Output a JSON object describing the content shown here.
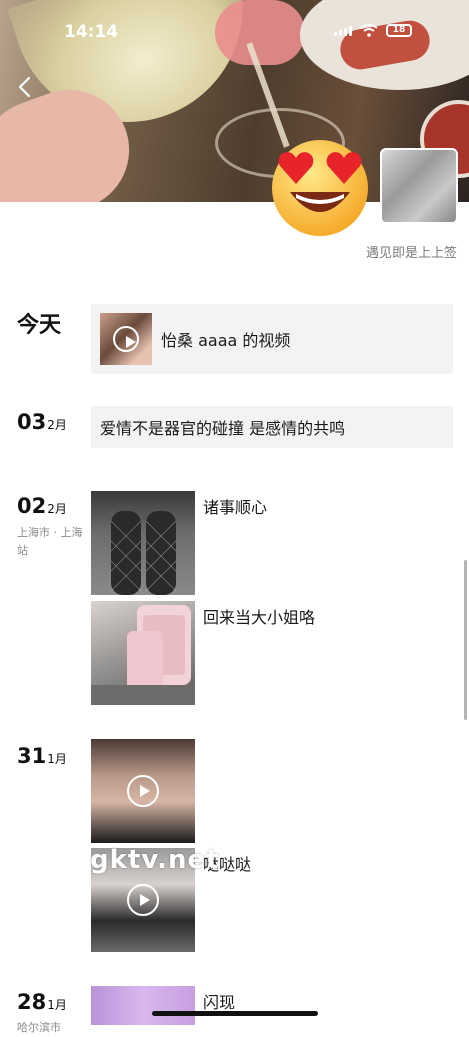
{
  "status_bar": {
    "time": "14:14",
    "battery": "18"
  },
  "profile": {
    "signature": "遇见即是上上签"
  },
  "timeline": {
    "today": {
      "label": "今天",
      "card_text": "怡桑 aaaa 的视频"
    },
    "feb03": {
      "day": "03",
      "month": "2月",
      "text": "爱情不是器官的碰撞 是感情的共鸣"
    },
    "feb02": {
      "day": "02",
      "month": "2月",
      "location": "上海市 · 上海站",
      "posts": [
        {
          "text": "诸事顺心"
        },
        {
          "text": "回来当大小姐咯"
        }
      ]
    },
    "jan31": {
      "day": "31",
      "month": "1月",
      "posts": [
        {
          "text": ""
        },
        {
          "text": "哒哒哒"
        }
      ]
    },
    "jan28": {
      "day": "28",
      "month": "1月",
      "location": "哈尔滨市",
      "posts": [
        {
          "text": "闪现"
        }
      ]
    }
  },
  "watermark": "gktv.net",
  "icons": {
    "back": "chevron-left-icon",
    "play": "play-icon",
    "emoji": "heart-eyes-emoji-icon"
  }
}
